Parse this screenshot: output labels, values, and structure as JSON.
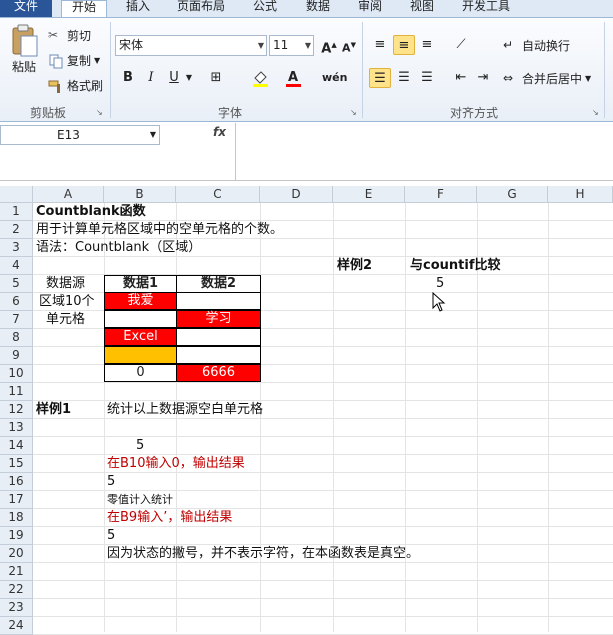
{
  "ribbon_tabs": [
    "文件",
    "开始",
    "插入",
    "页面布局",
    "公式",
    "数据",
    "审阅",
    "视图",
    "开发工具"
  ],
  "clipboard": {
    "paste": "粘贴",
    "cut": "剪切",
    "copy": "复制",
    "format_painter": "格式刷",
    "group": "剪贴板"
  },
  "font": {
    "name": "宋体",
    "size": "11",
    "grow": "A",
    "shrink": "A",
    "bold": "B",
    "italic": "I",
    "underline": "U",
    "wen": "wén",
    "group": "字体"
  },
  "alignment": {
    "wrap": "自动换行",
    "merge": "合并后居中",
    "group": "对齐方式"
  },
  "name_box": "E13",
  "fx": "fx",
  "columns": [
    "A",
    "B",
    "C",
    "D",
    "E",
    "F",
    "G",
    "H"
  ],
  "rows": [
    "1",
    "2",
    "3",
    "4",
    "5",
    "6",
    "7",
    "8",
    "9",
    "10",
    "11",
    "12",
    "13",
    "14",
    "15",
    "16",
    "17",
    "18",
    "19",
    "20",
    "21",
    "22",
    "23",
    "24"
  ],
  "sheet": {
    "r1": "Countblank函数",
    "r2": "用于计算单元格区域中的空单元格的个数。",
    "r3": "语法：Countblank（区域）",
    "e4": "样例2",
    "f4": "与countif比较",
    "f5": "5",
    "a5": "数据源",
    "a6": "区域10个",
    "a7": "单元格",
    "b5": "数据1",
    "c5": "数据2",
    "b6": "我爱",
    "c7": "学习",
    "b8": "Excel",
    "b10": "0",
    "c10": "6666",
    "a12": "样例1",
    "b12": "统计以上数据源空白单元格",
    "b14": "5",
    "b15": "在B10输入0，输出结果",
    "b16": "5",
    "b17": "零值计入统计",
    "b18": "在B9输入’，输出结果",
    "b19": "5",
    "b20": "因为状态的撇号，并不表示字符，在本函数表是真空。"
  },
  "colors": {
    "red_fill": "#ff0000",
    "orange_fill": "#ffc000",
    "red_text": "#c00000",
    "accent": "#2a5699"
  }
}
